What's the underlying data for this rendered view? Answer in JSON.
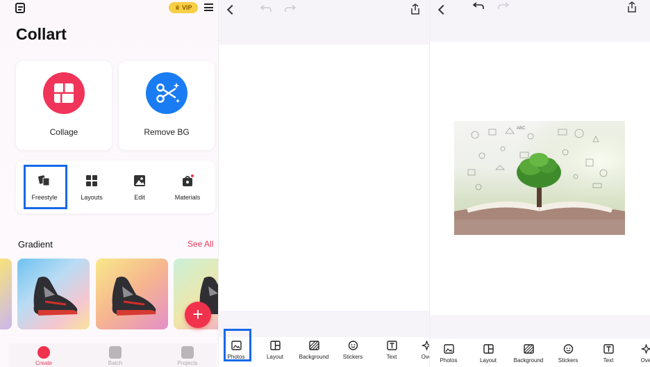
{
  "home": {
    "title": "Collart",
    "vip_label": "VIP",
    "feature_cards": [
      {
        "label": "Collage",
        "color": "#f0345a"
      },
      {
        "label": "Remove BG",
        "color": "#1a7cf2"
      }
    ],
    "tools": [
      {
        "label": "Freestyle"
      },
      {
        "label": "Layouts"
      },
      {
        "label": "Edit"
      },
      {
        "label": "Materials"
      }
    ],
    "gradient_section": {
      "title": "Gradient",
      "see_all": "See All"
    },
    "bottom_nav": [
      {
        "label": "Create"
      },
      {
        "label": "Batch"
      },
      {
        "label": "Projects"
      }
    ],
    "accent_color": "#e8395a",
    "highlight_color": "#1769e8"
  },
  "editor_toolbar": [
    {
      "label": "Photos"
    },
    {
      "label": "Layout"
    },
    {
      "label": "Background"
    },
    {
      "label": "Stickers"
    },
    {
      "label": "Text"
    },
    {
      "label": "Ove"
    }
  ]
}
